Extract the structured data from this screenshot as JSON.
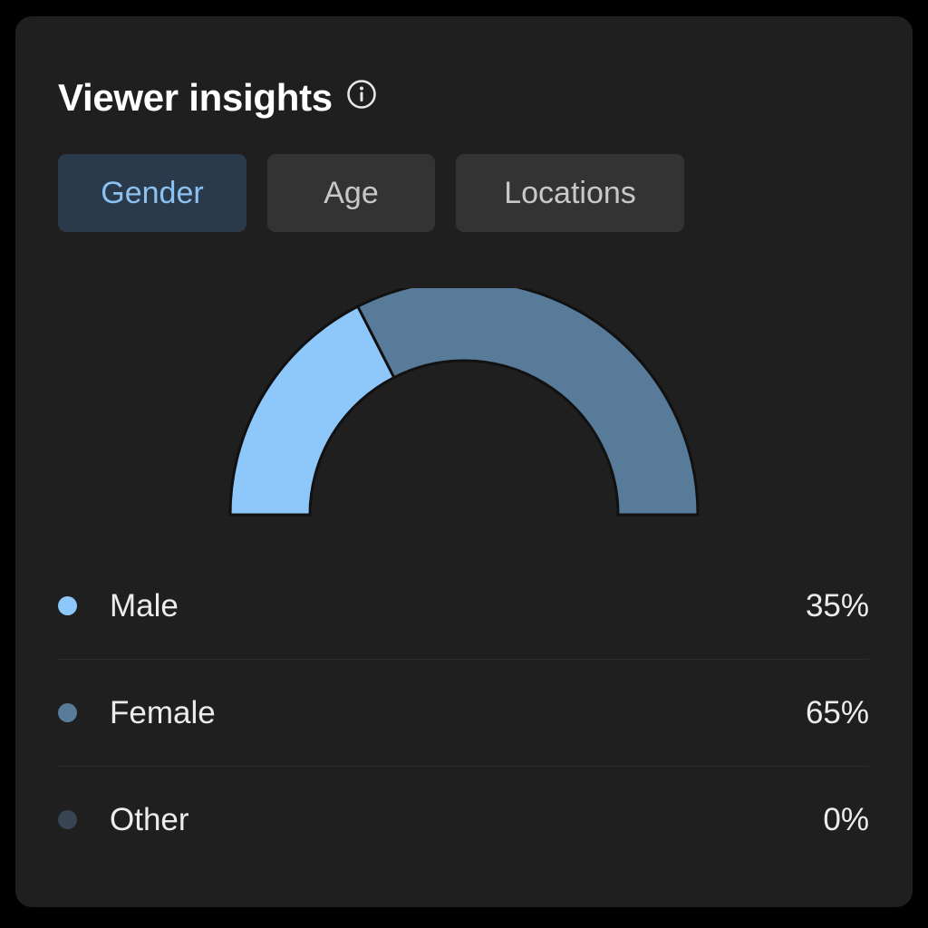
{
  "header": {
    "title": "Viewer insights",
    "info_icon": "info-circle-icon"
  },
  "tabs": [
    {
      "label": "Gender",
      "active": true
    },
    {
      "label": "Age",
      "active": false
    },
    {
      "label": "Locations",
      "active": false
    }
  ],
  "colors": {
    "male": "#8ec8fb",
    "female": "#587b99",
    "other": "#3a4553",
    "card_bg": "#1f1f1f",
    "active_tab_text": "#8cc2f2"
  },
  "chart_data": {
    "type": "pie",
    "style": "half-donut",
    "series": [
      {
        "name": "Male",
        "value": 35,
        "color": "#8ec8fb"
      },
      {
        "name": "Female",
        "value": 65,
        "color": "#587b99"
      },
      {
        "name": "Other",
        "value": 0,
        "color": "#3a4553"
      }
    ]
  },
  "legend": [
    {
      "label": "Male",
      "value": "35%"
    },
    {
      "label": "Female",
      "value": "65%"
    },
    {
      "label": "Other",
      "value": "0%"
    }
  ]
}
